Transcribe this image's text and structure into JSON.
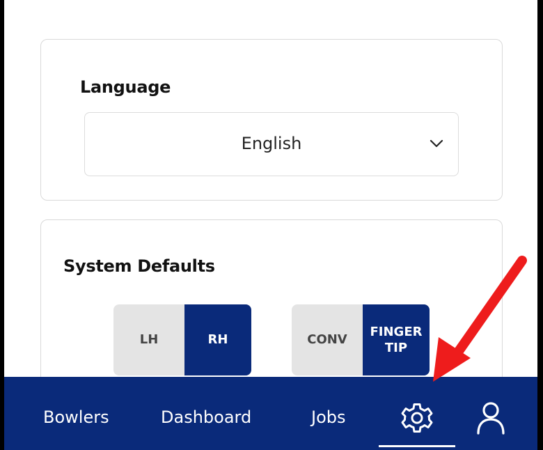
{
  "language_section": {
    "title": "Language",
    "selected_language": "English"
  },
  "system_defaults": {
    "title": "System Defaults",
    "hand_toggle": {
      "options": [
        "LH",
        "RH"
      ],
      "selected": "RH"
    },
    "grip_toggle": {
      "options": [
        "CONV",
        "FINGER TIP"
      ],
      "option_line_1": "FINGER",
      "option_line_2": "TIP",
      "selected": "FINGER TIP"
    }
  },
  "bottom_nav": {
    "items": [
      {
        "label": "Bowlers"
      },
      {
        "label": "Dashboard"
      },
      {
        "label": "Jobs"
      },
      {
        "icon": "gear-icon",
        "active": true
      },
      {
        "icon": "user-icon"
      }
    ]
  },
  "colors": {
    "primary": "#0a2a7a",
    "toggle_off": "#e4e4e4",
    "annotation_arrow": "#ee1c1c"
  }
}
